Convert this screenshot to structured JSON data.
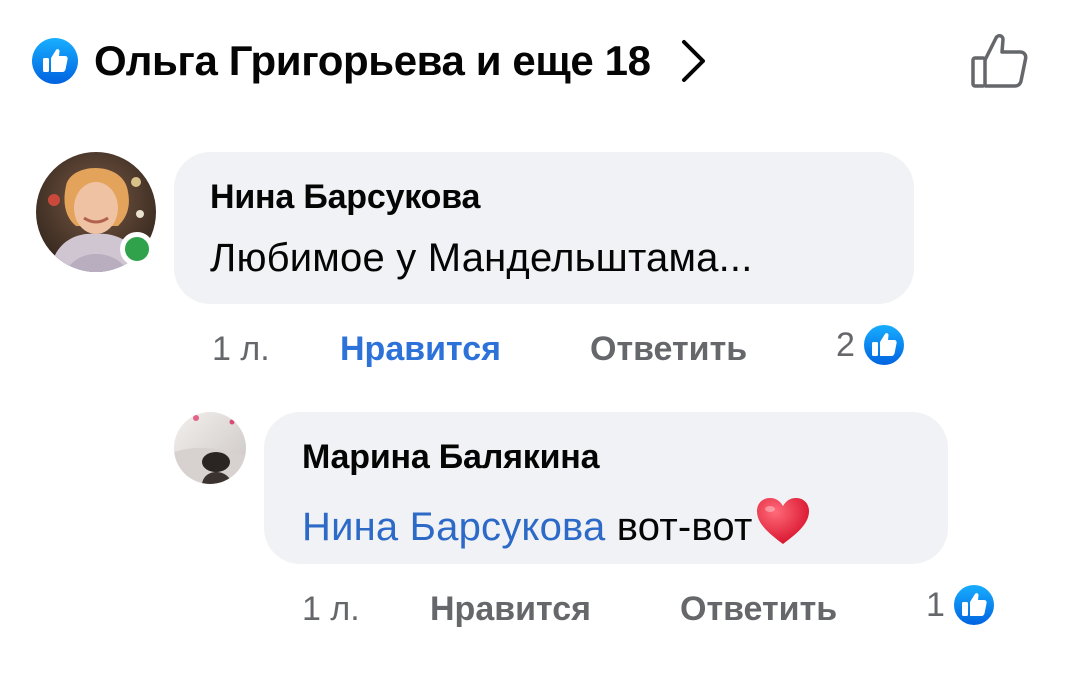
{
  "header": {
    "reactions_summary": "Ольга Григорьева и еще 18",
    "icons": {
      "reaction": "like-badge-icon",
      "more": "chevron-right-icon",
      "like_action": "thumbs-up-outline-icon"
    }
  },
  "colors": {
    "like_blue": "#1877f2",
    "link_blue": "#2d6ac8",
    "bubble_bg": "#f0f2f5",
    "secondary_text": "#65676b",
    "online_green": "#31a24c",
    "heart_red": "#e0102e"
  },
  "comments": [
    {
      "author": "Нина Барсукова",
      "text": "Любимое у Мандельштама...",
      "online": true,
      "time": "1 л.",
      "like_label": "Нравится",
      "like_active": true,
      "reply_label": "Ответить",
      "reaction_count": "2",
      "reaction_icon": "like-badge-icon"
    },
    {
      "author": "Марина Балякина",
      "mention": "Нина Барсукова",
      "text": "вот-вот",
      "emoji": "heart-emoji-icon",
      "time": "1 л.",
      "like_label": "Нравится",
      "like_active": false,
      "reply_label": "Ответить",
      "reaction_count": "1",
      "reaction_icon": "like-badge-icon"
    }
  ]
}
